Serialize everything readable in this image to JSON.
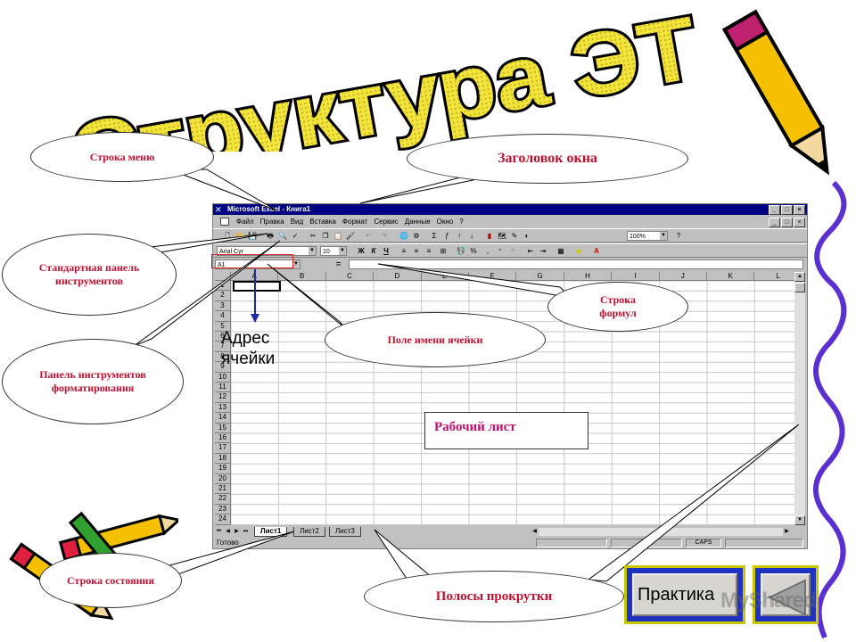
{
  "slide": {
    "title": "Структура ЭТ",
    "address_label": "Адрес ячейки",
    "worksheet_label": "Рабочий лист",
    "practice_button": "Практика",
    "watermark": "MyShared"
  },
  "callouts": {
    "menu_bar": "Строка меню",
    "window_title": "Заголовок окна",
    "standard_toolbar": "Стандартная панель инструментов",
    "formatting_toolbar": "Панель инструментов форматирования",
    "formula_bar": "Строка формул",
    "name_box": "Поле имени ячейки",
    "status_bar": "Строка состояния",
    "scrollbars": "Полосы прокрутки"
  },
  "excel": {
    "window_title": "Microsoft Excel - Книга1",
    "window_controls": [
      "_",
      "□",
      "×"
    ],
    "menu": [
      "Файл",
      "Правка",
      "Вид",
      "Вставка",
      "Формат",
      "Сервис",
      "Данные",
      "Окно",
      "?"
    ],
    "zoom": "100%",
    "font_name": "Arial Cyr",
    "font_size": "10",
    "name_box_value": "A1",
    "formula_eq": "=",
    "fmt_buttons": [
      "Ж",
      "К",
      "Ч"
    ],
    "columns": [
      "A",
      "B",
      "C",
      "D",
      "E",
      "F",
      "G",
      "H",
      "I",
      "J",
      "K",
      "L"
    ],
    "rows": [
      "1",
      "2",
      "3",
      "4",
      "5",
      "6",
      "7",
      "8",
      "9",
      "10",
      "11",
      "12",
      "13",
      "14",
      "15",
      "16",
      "17",
      "18",
      "19",
      "20",
      "21",
      "22",
      "23",
      "24"
    ],
    "sheets": [
      "Лист1",
      "Лист2",
      "Лист3"
    ],
    "status_text": "Готово",
    "caps": "CAPS"
  },
  "colors": {
    "callout_text": "#c01030",
    "title_fill": "#f2e43a",
    "titlebar": "#000080",
    "practice_border": "#c8c800",
    "practice_bg": "#2033c0"
  }
}
